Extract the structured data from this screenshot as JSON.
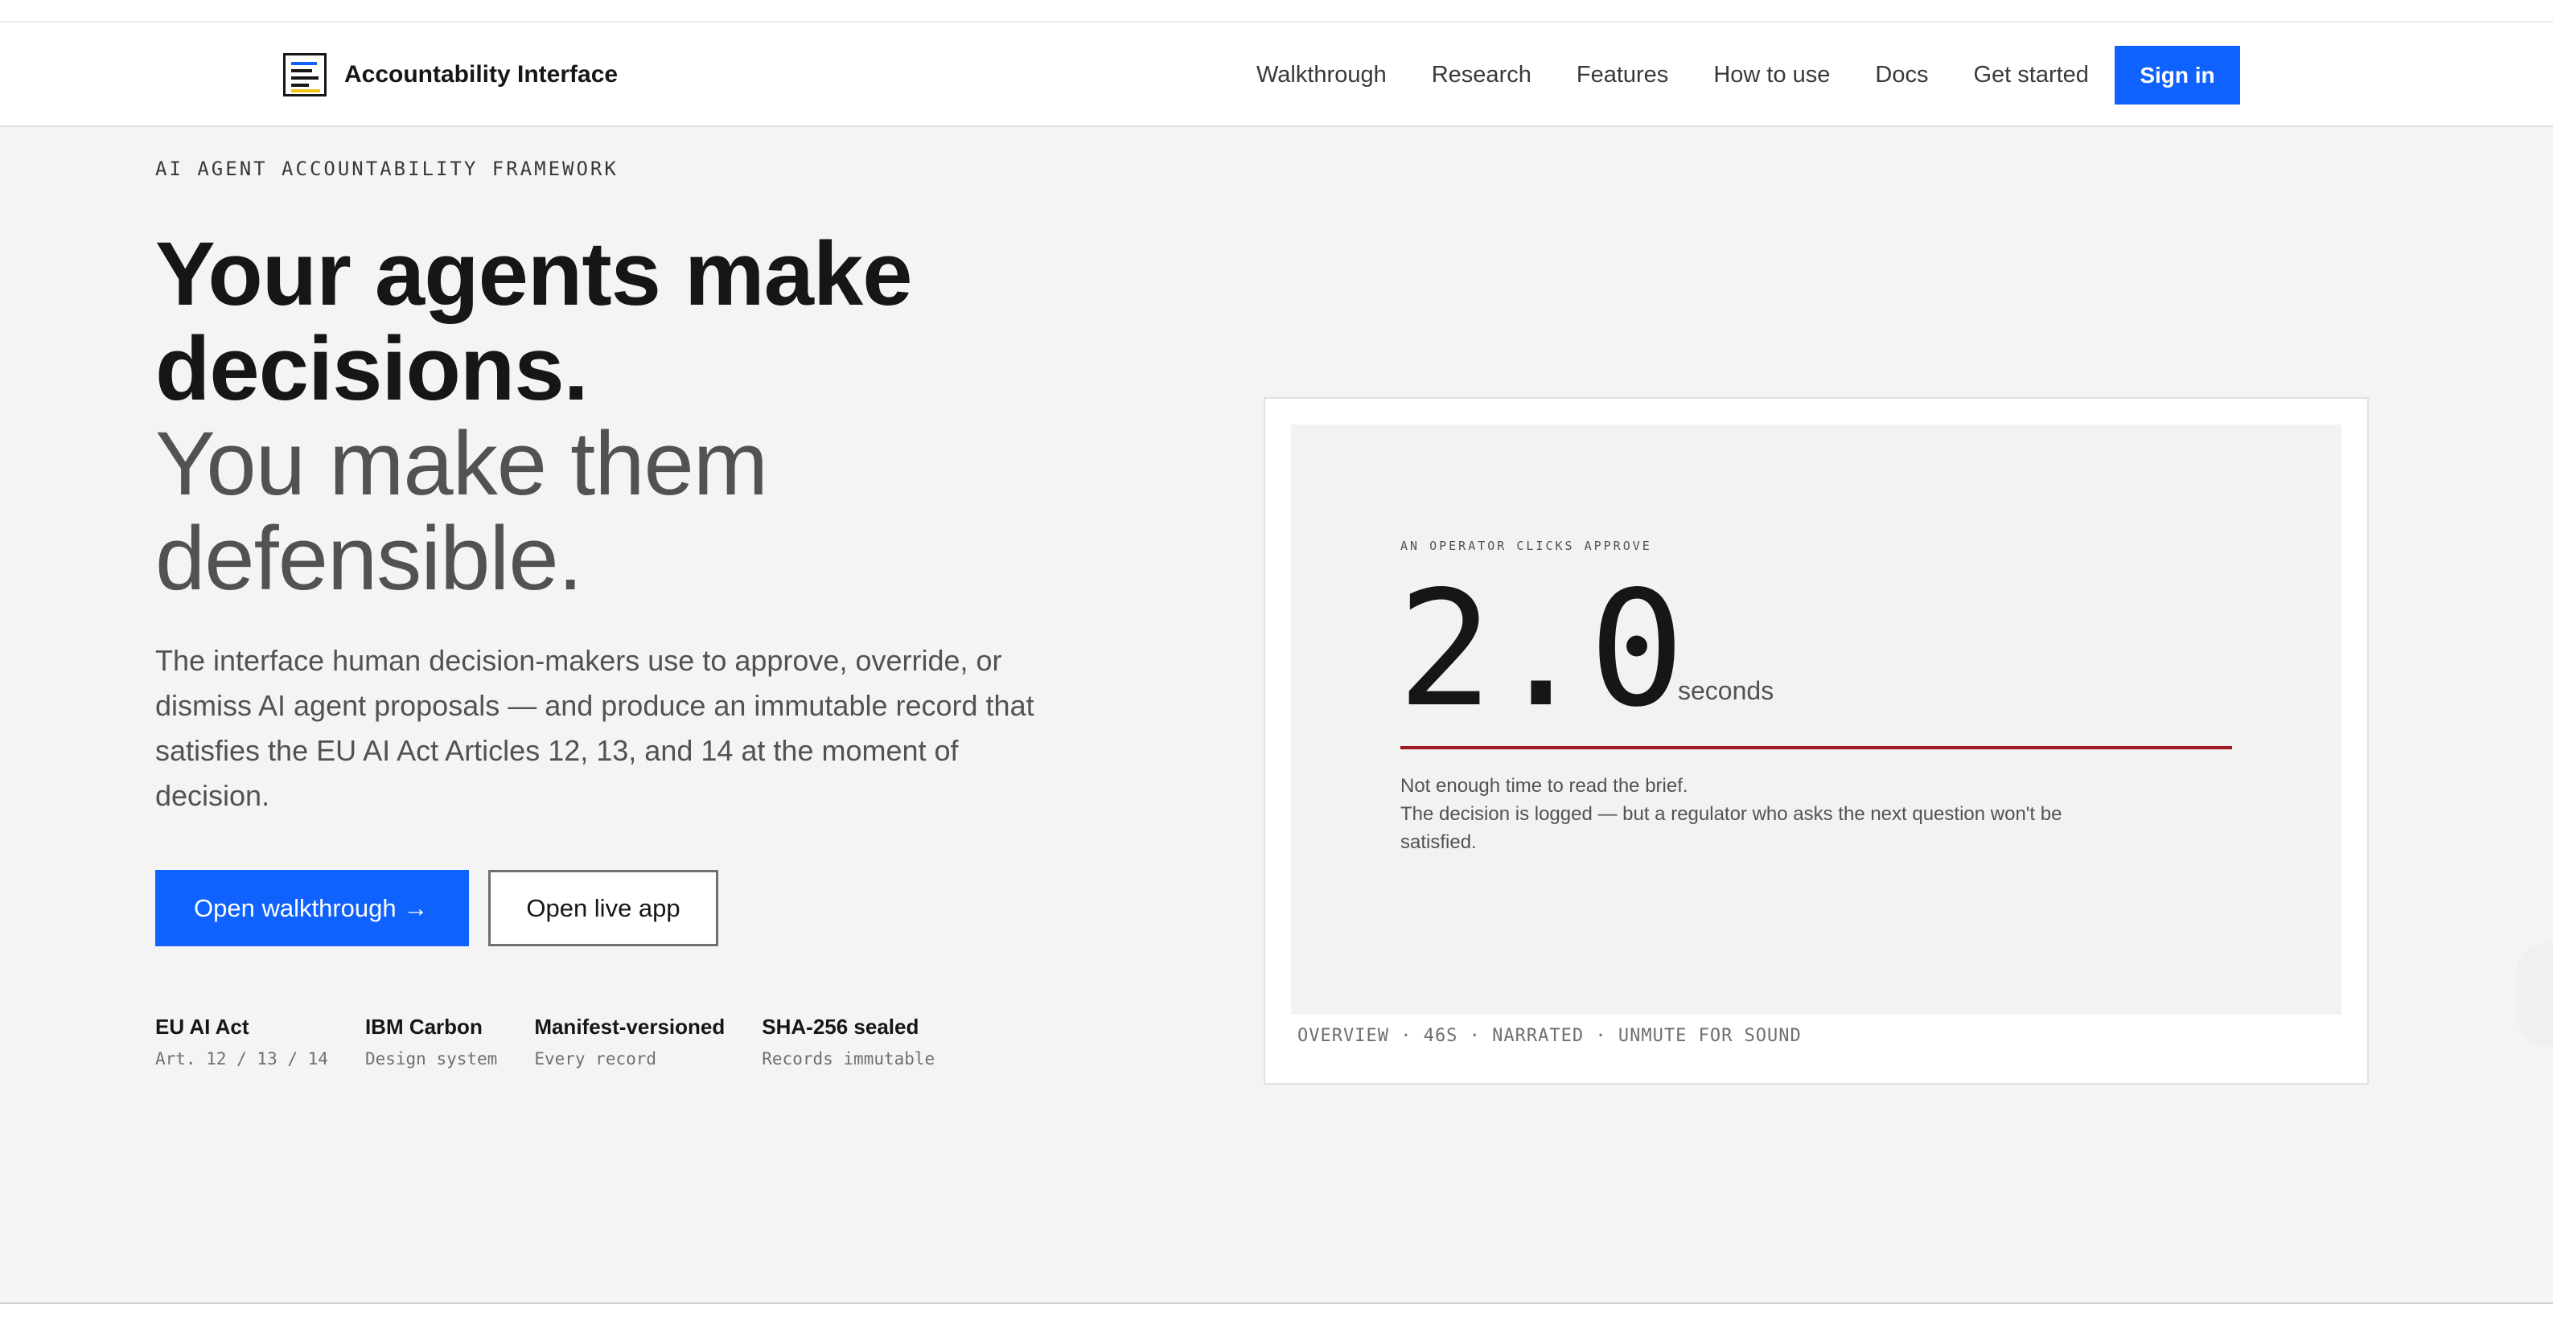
{
  "header": {
    "brand_name": "Accountability Interface",
    "nav": [
      {
        "label": "Walkthrough"
      },
      {
        "label": "Research"
      },
      {
        "label": "Features"
      },
      {
        "label": "How to use"
      },
      {
        "label": "Docs"
      },
      {
        "label": "Get started"
      }
    ],
    "signin_label": "Sign in"
  },
  "hero": {
    "eyebrow": "AI AGENT ACCOUNTABILITY FRAMEWORK",
    "headline_line1": "Your agents make decisions.",
    "headline_line2": "You make them defensible.",
    "lede": "The interface human decision-makers use to approve, override, or dismiss AI agent proposals — and produce an immutable record that satisfies the EU AI Act Articles 12, 13, and 14 at the moment of decision.",
    "primary_cta": "Open walkthrough →",
    "secondary_cta": "Open live app",
    "facts": [
      {
        "title": "EU AI Act",
        "sub": "Art. 12 / 13 / 14"
      },
      {
        "title": "IBM Carbon",
        "sub": "Design system"
      },
      {
        "title": "Manifest-versioned",
        "sub": "Every record"
      },
      {
        "title": "SHA-256 sealed",
        "sub": "Records immutable"
      }
    ]
  },
  "video_card": {
    "eyebrow": "AN OPERATOR CLICKS APPROVE",
    "number": "2.0",
    "unit": "seconds",
    "caption_line1": "Not enough time to read the brief.",
    "caption_line2": "The decision is logged — but a regulator who asks the next question won't be satisfied.",
    "footer": "OVERVIEW · 46S · NARRATED · UNMUTE FOR SOUND"
  },
  "colors": {
    "accent": "#0f62fe",
    "danger_rule": "#a2191f",
    "hero_bg": "#f4f4f4",
    "brand_icon_highlight": "#f1c21b"
  },
  "icons": {
    "brand": "document-lines-icon"
  }
}
